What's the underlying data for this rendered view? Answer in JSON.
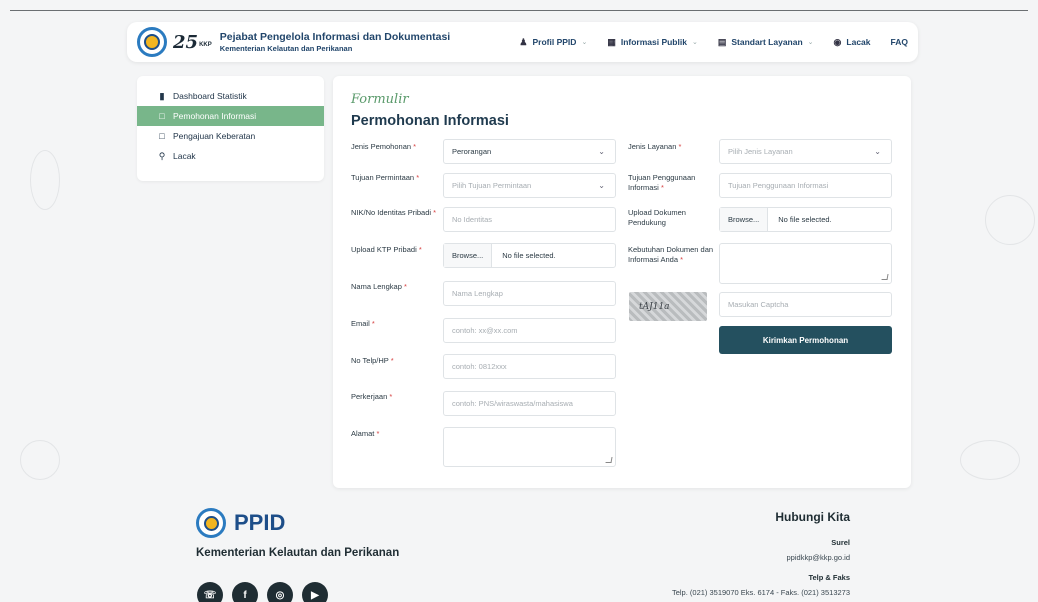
{
  "header": {
    "title": "Pejabat Pengelola Informasi dan Dokumentasi",
    "subtitle": "Kementerian Kelautan dan Perikanan",
    "anniversary": "25",
    "badge": "KKP",
    "nav": [
      {
        "label": "Profil PPID",
        "icon": "people-icon"
      },
      {
        "label": "Informasi Publik",
        "icon": "grid-icon"
      },
      {
        "label": "Standart Layanan",
        "icon": "document-icon"
      },
      {
        "label": "Lacak",
        "icon": "target-icon"
      },
      {
        "label": "FAQ"
      }
    ]
  },
  "sidebar": {
    "items": [
      {
        "label": "Dashboard Statistik",
        "icon": "bar-chart-icon"
      },
      {
        "label": "Pemohonan Informasi",
        "icon": "clipboard-icon",
        "active": true
      },
      {
        "label": "Pengajuan Keberatan",
        "icon": "clipboard-icon"
      },
      {
        "label": "Lacak",
        "icon": "location-pin-icon"
      }
    ]
  },
  "form": {
    "subtitle": "Formulir",
    "title": "Permohonan Informasi",
    "left": {
      "jenis_pemohon": {
        "label": "Jenis Pemohonan",
        "value": "Perorangan"
      },
      "tujuan_permintaan": {
        "label": "Tujuan Permintaan",
        "placeholder": "Pilih Tujuan Permintaan"
      },
      "nik": {
        "label": "NIK/No Identitas Pribadi",
        "placeholder": "No Identitas"
      },
      "ktp": {
        "label": "Upload KTP Pribadi",
        "browse": "Browse...",
        "status": "No file selected."
      },
      "nama": {
        "label": "Nama Lengkap",
        "placeholder": "Nama Lengkap"
      },
      "email": {
        "label": "Email",
        "placeholder": "contoh: xx@xx.com"
      },
      "telp": {
        "label": "No Telp/HP",
        "placeholder": "contoh: 0812xxx"
      },
      "pekerjaan": {
        "label": "Perkerjaan",
        "placeholder": "contoh: PNS/wiraswasta/mahasiswa"
      },
      "alamat": {
        "label": "Alamat"
      }
    },
    "right": {
      "jenis_layanan": {
        "label": "Jenis Layanan",
        "placeholder": "Pilih Jenis Layanan"
      },
      "tujuan_penggunaan": {
        "label": "Tujuan Penggunaan Informasi",
        "placeholder": "Tujuan Penggunaan Informasi"
      },
      "dokumen": {
        "label": "Upload Dokumen Pendukung",
        "browse": "Browse...",
        "status": "No file selected."
      },
      "kebutuhan": {
        "label": "Kebutuhan Dokumen dan Informasi Anda"
      },
      "captcha": {
        "image_text": "tAJ11a",
        "placeholder": "Masukan Captcha"
      },
      "submit": "Kirimkan Permohonan"
    },
    "required_mark": "*"
  },
  "footer": {
    "brand": "PPID",
    "ministry": "Kementerian Kelautan dan Perikanan",
    "contact_title": "Hubungi Kita",
    "email_label": "Surel",
    "email": "ppidkkp@kkp.go.id",
    "phone_label": "Telp & Faks",
    "phone": "Telp. (021) 3519070 Eks. 6174 - Faks. (021) 3513273",
    "socials": [
      "headset-icon",
      "facebook-icon",
      "instagram-icon",
      "youtube-icon"
    ]
  },
  "colors": {
    "primary": "#24505f",
    "active_sidebar": "#78b68a",
    "accent_green": "#5a9a6b",
    "required": "#d64040",
    "brand_blue": "#1d4e89"
  }
}
